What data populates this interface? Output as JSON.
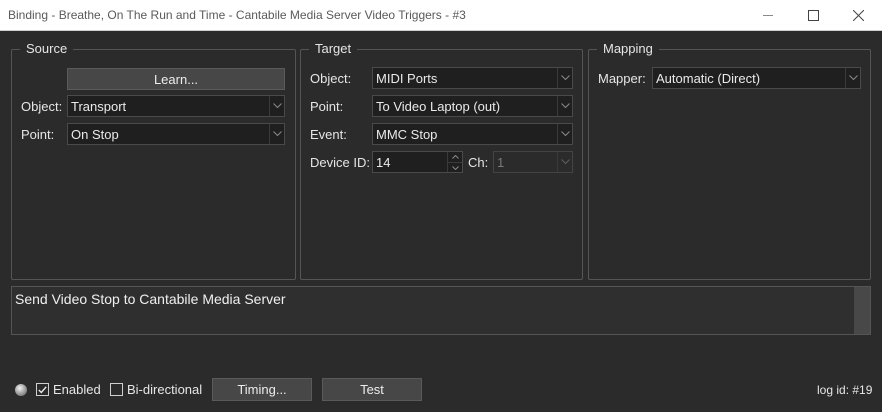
{
  "window": {
    "title": "Binding - Breathe, On The Run and Time - Cantabile Media Server Video Triggers - #3"
  },
  "source": {
    "legend": "Source",
    "learn_label": "Learn...",
    "object_label": "Object:",
    "object_value": "Transport",
    "point_label": "Point:",
    "point_value": "On Stop"
  },
  "target": {
    "legend": "Target",
    "object_label": "Object:",
    "object_value": "MIDI Ports",
    "point_label": "Point:",
    "point_value": "To Video Laptop (out)",
    "event_label": "Event:",
    "event_value": "MMC Stop",
    "device_id_label": "Device ID:",
    "device_id_value": "14",
    "ch_label": "Ch:",
    "ch_value": "1"
  },
  "mapping": {
    "legend": "Mapping",
    "mapper_label": "Mapper:",
    "mapper_value": "Automatic (Direct)"
  },
  "description": "Send Video Stop to Cantabile Media Server",
  "footer": {
    "enabled_label": "Enabled",
    "enabled_checked": true,
    "bidirectional_label": "Bi-directional",
    "bidirectional_checked": false,
    "timing_label": "Timing...",
    "test_label": "Test",
    "log_id": "log id: #19"
  }
}
